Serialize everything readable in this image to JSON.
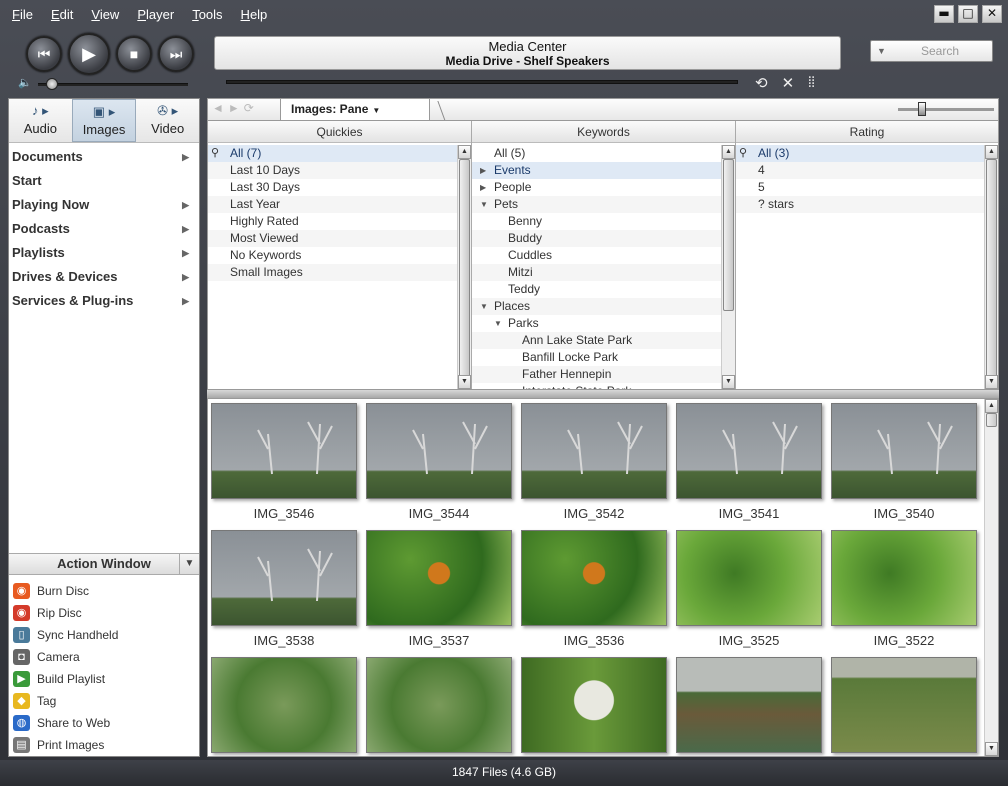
{
  "menu": [
    "File",
    "Edit",
    "View",
    "Player",
    "Tools",
    "Help"
  ],
  "window_buttons": {
    "minimize": "▬",
    "maximize": "□",
    "close": "✕"
  },
  "player": {
    "display_line1": "Media Center",
    "display_line2": "Media Drive - Shelf Speakers",
    "search_placeholder": "Search"
  },
  "media_tabs": [
    {
      "label": "Audio",
      "icon": "music-note-icon"
    },
    {
      "label": "Images",
      "icon": "camera-icon"
    },
    {
      "label": "Video",
      "icon": "film-reel-icon"
    }
  ],
  "nav_items": [
    {
      "label": "Documents",
      "arrow": true
    },
    {
      "label": "Start",
      "arrow": false
    },
    {
      "label": "Playing Now",
      "arrow": true
    },
    {
      "label": "Podcasts",
      "arrow": true
    },
    {
      "label": "Playlists",
      "arrow": true
    },
    {
      "label": "Drives & Devices",
      "arrow": true
    },
    {
      "label": "Services & Plug-ins",
      "arrow": true
    }
  ],
  "action_window": {
    "title": "Action Window",
    "items": [
      {
        "label": "Burn Disc",
        "icon": "burn-disc-icon",
        "color": "#e85a20"
      },
      {
        "label": "Rip Disc",
        "icon": "rip-disc-icon",
        "color": "#d43a2a"
      },
      {
        "label": "Sync Handheld",
        "icon": "handheld-icon",
        "color": "#4a7a9a"
      },
      {
        "label": "Camera",
        "icon": "camera-icon",
        "color": "#666666"
      },
      {
        "label": "Build Playlist",
        "icon": "playlist-icon",
        "color": "#3a9a3a"
      },
      {
        "label": "Tag",
        "icon": "tag-icon",
        "color": "#e8b820"
      },
      {
        "label": "Share to Web",
        "icon": "globe-icon",
        "color": "#2a6ac8"
      },
      {
        "label": "Print Images",
        "icon": "printer-icon",
        "color": "#777777"
      }
    ]
  },
  "toolbar": {
    "view_tab": "Images: Pane"
  },
  "panes": {
    "quickies": {
      "header": "Quickies",
      "items": [
        "All (7)",
        "Last 10 Days",
        "Last 30 Days",
        "Last Year",
        "Highly Rated",
        "Most Viewed",
        "No Keywords",
        "Small Images"
      ]
    },
    "keywords": {
      "header": "Keywords",
      "items": [
        {
          "label": "All (5)",
          "indent": 0,
          "tri": ""
        },
        {
          "label": "Events",
          "indent": 0,
          "tri": "right"
        },
        {
          "label": "People",
          "indent": 0,
          "tri": "right"
        },
        {
          "label": "Pets",
          "indent": 0,
          "tri": "down"
        },
        {
          "label": "Benny",
          "indent": 1,
          "tri": ""
        },
        {
          "label": "Buddy",
          "indent": 1,
          "tri": ""
        },
        {
          "label": "Cuddles",
          "indent": 1,
          "tri": ""
        },
        {
          "label": "Mitzi",
          "indent": 1,
          "tri": ""
        },
        {
          "label": "Teddy",
          "indent": 1,
          "tri": ""
        },
        {
          "label": "Places",
          "indent": 0,
          "tri": "down"
        },
        {
          "label": "Parks",
          "indent": 1,
          "tri": "down"
        },
        {
          "label": "Ann Lake State Park",
          "indent": 2,
          "tri": ""
        },
        {
          "label": "Banfill Locke Park",
          "indent": 2,
          "tri": ""
        },
        {
          "label": "Father Hennepin",
          "indent": 2,
          "tri": ""
        },
        {
          "label": "Interstate State Park",
          "indent": 2,
          "tri": ""
        }
      ]
    },
    "rating": {
      "header": "Rating",
      "items": [
        "All (3)",
        "4",
        "5",
        "? stars"
      ]
    }
  },
  "thumbnails": [
    {
      "caption": "IMG_3546",
      "scene": "sky-tree"
    },
    {
      "caption": "IMG_3544",
      "scene": "sky-tree"
    },
    {
      "caption": "IMG_3542",
      "scene": "sky-tree"
    },
    {
      "caption": "IMG_3541",
      "scene": "sky-tree"
    },
    {
      "caption": "IMG_3540",
      "scene": "sky-tree"
    },
    {
      "caption": "IMG_3538",
      "scene": "sky-tree"
    },
    {
      "caption": "IMG_3537",
      "scene": "butterfly"
    },
    {
      "caption": "IMG_3536",
      "scene": "butterfly"
    },
    {
      "caption": "IMG_3525",
      "scene": "leaves"
    },
    {
      "caption": "IMG_3522",
      "scene": "leaves"
    },
    {
      "caption": "",
      "scene": "blur-green"
    },
    {
      "caption": "",
      "scene": "blur-green"
    },
    {
      "caption": "",
      "scene": "dandelion"
    },
    {
      "caption": "",
      "scene": "marsh"
    },
    {
      "caption": "",
      "scene": "logs"
    }
  ],
  "status": "1847 Files (4.6 GB)"
}
